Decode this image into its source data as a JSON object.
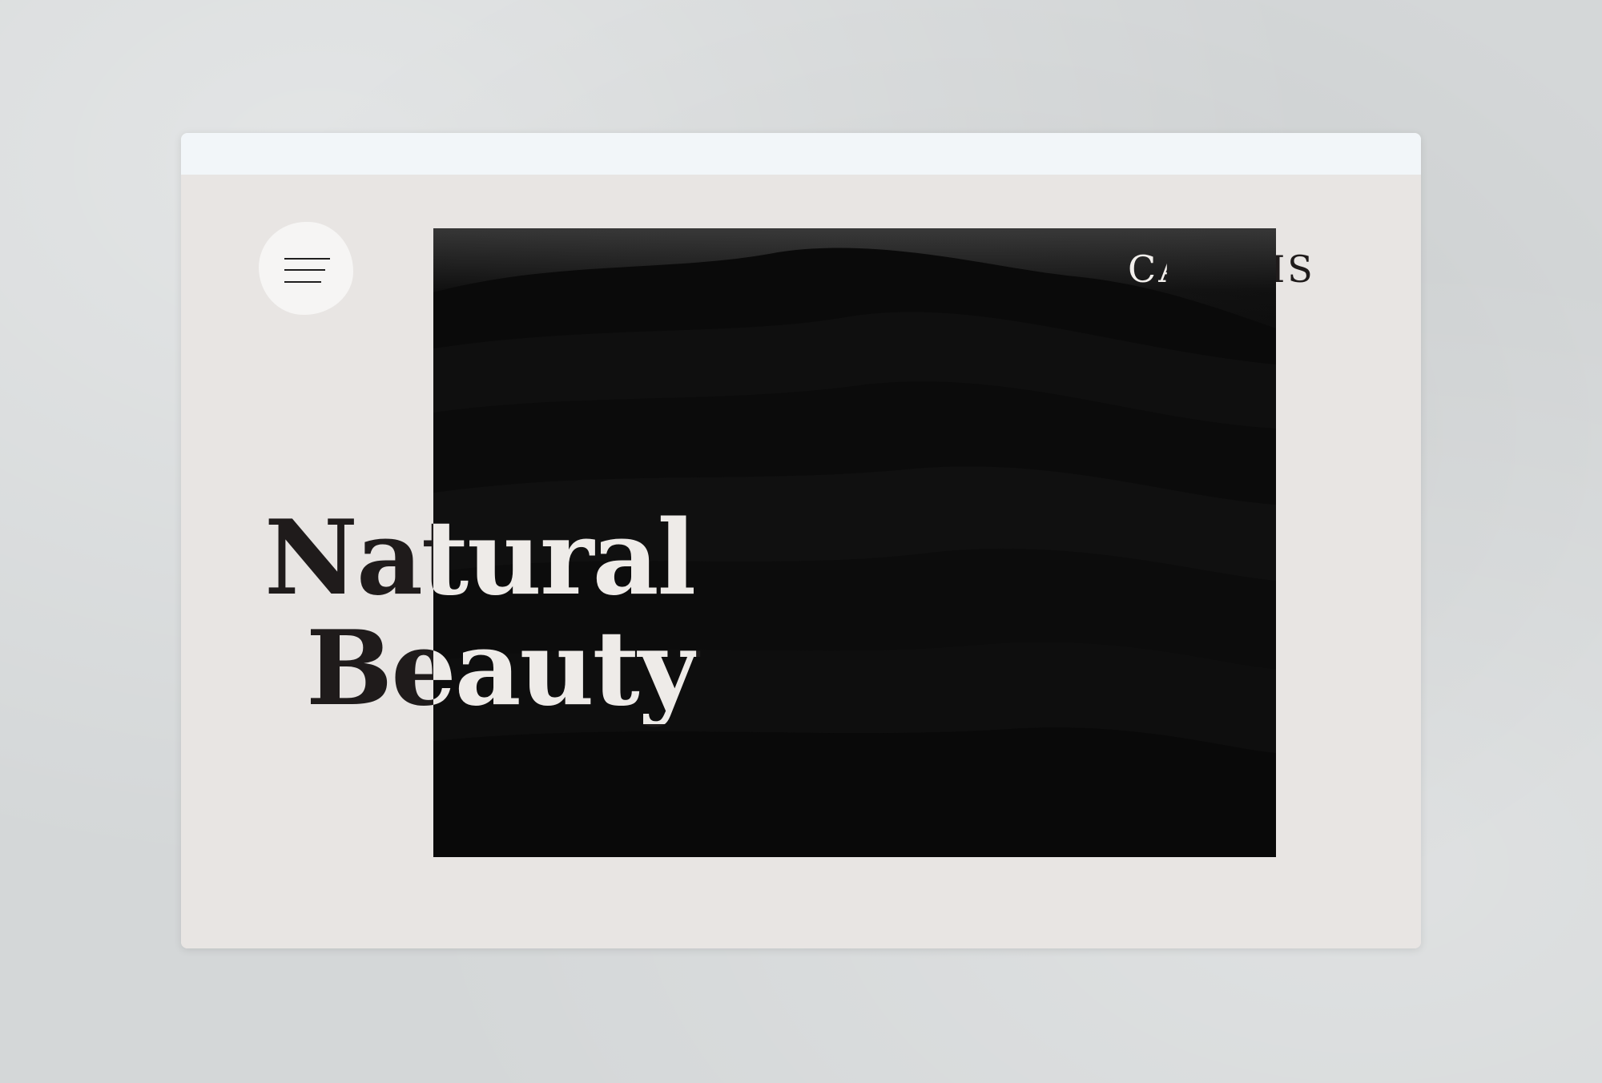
{
  "site": {
    "brand": "CALLEIS",
    "hero_title_line1": "Natural",
    "hero_title_line2": "Beauty"
  },
  "icons": {
    "menu": "hamburger-menu-icon"
  },
  "colors": {
    "background": "#d4d7d8",
    "page": "#e8e5e3",
    "browser_bar": "#f2f6f9",
    "text_dark": "#1f1b1b",
    "text_light": "#eeebe8",
    "image_dark": "#0d0d0d"
  }
}
